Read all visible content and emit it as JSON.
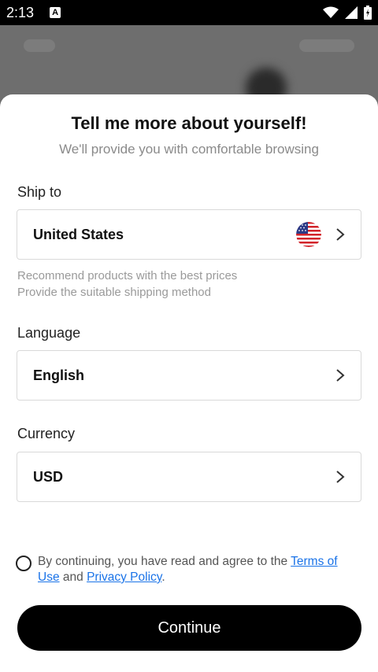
{
  "status_bar": {
    "time": "2:13",
    "notification_letter": "A",
    "icons": [
      "wifi-icon",
      "signal-icon",
      "battery-icon"
    ]
  },
  "sheet": {
    "title": "Tell me more about yourself!",
    "subtitle": "We'll provide you with comfortable browsing"
  },
  "ship_to": {
    "label": "Ship to",
    "value": "United States",
    "flag_icon": "us-flag-icon",
    "hint_line1": "Recommend products with the best prices",
    "hint_line2": "Provide the suitable shipping method"
  },
  "language": {
    "label": "Language",
    "value": "English"
  },
  "currency": {
    "label": "Currency",
    "value": "USD"
  },
  "agreement": {
    "prefix": "By continuing, you have read and agree to the ",
    "terms_link": "Terms of Use",
    "middle": " and ",
    "privacy_link": "Privacy Policy",
    "suffix": ".",
    "checked": false
  },
  "continue_button": {
    "label": "Continue"
  },
  "colors": {
    "accent_link": "#1a73e8",
    "button_bg": "#000000",
    "backdrop": "#6e6e6e"
  }
}
